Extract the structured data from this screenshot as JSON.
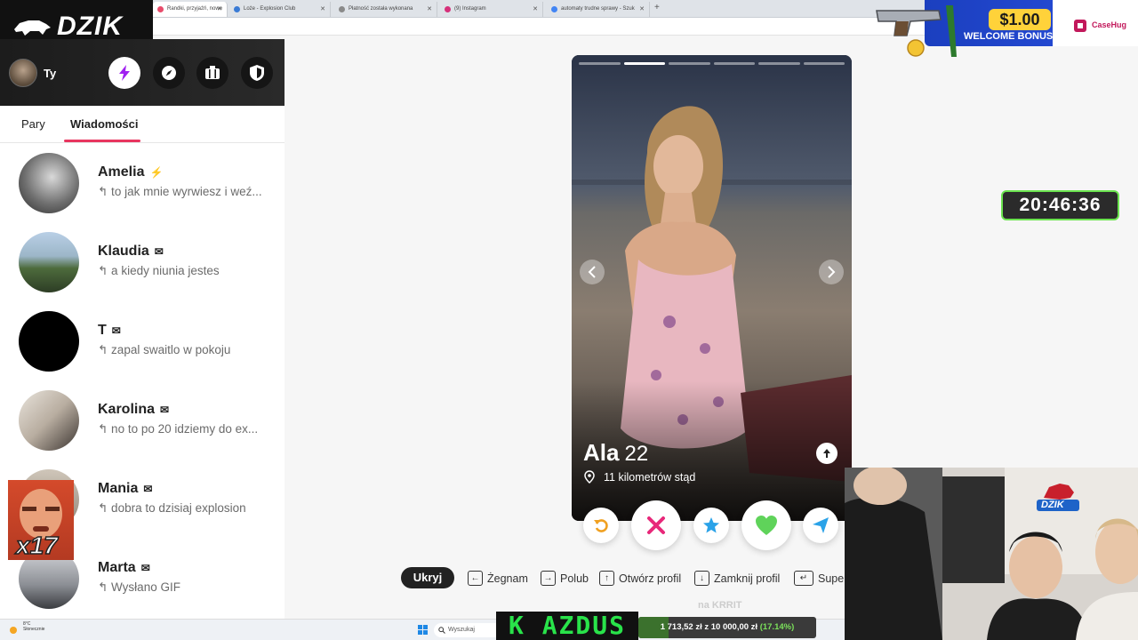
{
  "browser": {
    "tabs": [
      {
        "label": "Randki, przyjaźń, nowe"
      },
      {
        "label": "Loże - Explosion Club"
      },
      {
        "label": "Płatność została wykonana"
      },
      {
        "label": "(9) Instagram"
      },
      {
        "label": "automaty trudne sprawy - Szuk"
      }
    ],
    "new_tab": "+"
  },
  "stream_logo": {
    "text": "DZIK"
  },
  "header": {
    "user_name": "Ty",
    "icons": [
      "lightning-icon",
      "compass-icon",
      "briefcase-icon",
      "shield-icon"
    ]
  },
  "tabs": {
    "pairs": "Pary",
    "messages": "Wiadomości"
  },
  "conversations": [
    {
      "name": "Amelia",
      "badge": "⚡",
      "message": "↰ to jak mnie wyrwiesz i weź..."
    },
    {
      "name": "Klaudia",
      "badge": "✉",
      "message": "↰ a kiedy niunia jestes"
    },
    {
      "name": "T",
      "badge": "✉",
      "message": "↰ zapal swaitlo w pokoju"
    },
    {
      "name": "Karolina",
      "badge": "✉",
      "message": "↰ no to po 20 idziemy do ex..."
    },
    {
      "name": "Mania",
      "badge": "✉",
      "message": "↰ dobra to dzisiaj explosion"
    },
    {
      "name": "Marta",
      "badge": "✉",
      "message": "↰ Wysłano GIF"
    }
  ],
  "profile": {
    "name": "Ala",
    "age": "22",
    "distance": "11 kilometrów stąd",
    "photo_count": 6,
    "active_photo": 2
  },
  "actions": [
    "undo-icon",
    "nope-icon",
    "super-like-icon",
    "like-icon",
    "boost-icon"
  ],
  "shortcuts": {
    "hide": "Ukryj",
    "items": [
      {
        "key": "←",
        "label": "Żegnam"
      },
      {
        "key": "→",
        "label": "Polub"
      },
      {
        "key": "↑",
        "label": "Otwórz profil"
      },
      {
        "key": "↓",
        "label": "Zamknij profil"
      },
      {
        "key": "↵",
        "label": "Supe"
      }
    ]
  },
  "timer": "20:46:36",
  "banner": {
    "amount": "$1.00",
    "label": "WELCOME BONUS",
    "brand": "CaseHug"
  },
  "meme": {
    "count": "x17"
  },
  "taskbar": {
    "weather_temp": "8°C",
    "weather_desc": "Słonecznie",
    "search": "Wyszukaj"
  },
  "overlay": {
    "kazdus": "K AZDUS",
    "donation_text": "1 713,52 zł z 10 000,00 zł",
    "donation_pct": "(17.14%)",
    "donation_progress": 0.1714,
    "krrit": "na KRRIT"
  },
  "colors": {
    "accent": "#e8355f",
    "timer_border": "#6be34f",
    "like_green": "#35c85a",
    "nope_pink": "#e8287a",
    "star_blue": "#2aa2e8"
  }
}
